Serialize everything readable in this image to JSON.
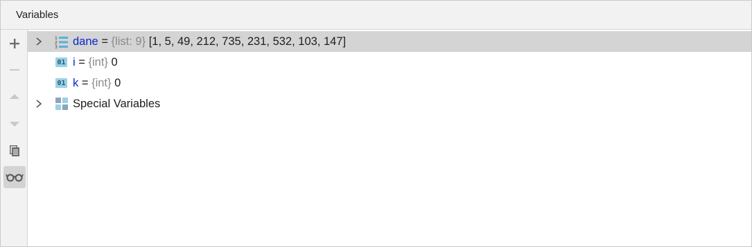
{
  "panel": {
    "title": "Variables"
  },
  "toolbar": {
    "buttons": [
      {
        "name": "add-watch-button",
        "icon": "plus-icon",
        "enabled": true
      },
      {
        "name": "remove-watch-button",
        "icon": "minus-icon",
        "enabled": false
      },
      {
        "name": "move-up-button",
        "icon": "arrow-up-icon",
        "enabled": false
      },
      {
        "name": "move-down-button",
        "icon": "arrow-down-icon",
        "enabled": false
      },
      {
        "name": "copy-button",
        "icon": "copy-icon",
        "enabled": true
      },
      {
        "name": "show-watches-toggle",
        "icon": "glasses-icon",
        "enabled": true,
        "active": true
      }
    ]
  },
  "variables": [
    {
      "name": "dane",
      "eq": "=",
      "type": "{list: 9}",
      "value": "[1, 5, 49, 212, 735, 231, 532, 103, 147]",
      "icon": "list-icon",
      "expandable": true,
      "selected": true
    },
    {
      "name": "i",
      "eq": "=",
      "type": "{int}",
      "value": "0",
      "icon": "int-icon",
      "badge": "01",
      "expandable": false
    },
    {
      "name": "k",
      "eq": "=",
      "type": "{int}",
      "value": "0",
      "icon": "int-icon",
      "badge": "01",
      "expandable": false
    },
    {
      "label": "Special Variables",
      "icon": "special-variables-icon",
      "expandable": true
    }
  ],
  "colors": {
    "variable_name": "#0a28c8",
    "type_hint": "#8a8a8a",
    "selection": "#d4d4d4",
    "icon_accent": "#5bb0d6"
  }
}
